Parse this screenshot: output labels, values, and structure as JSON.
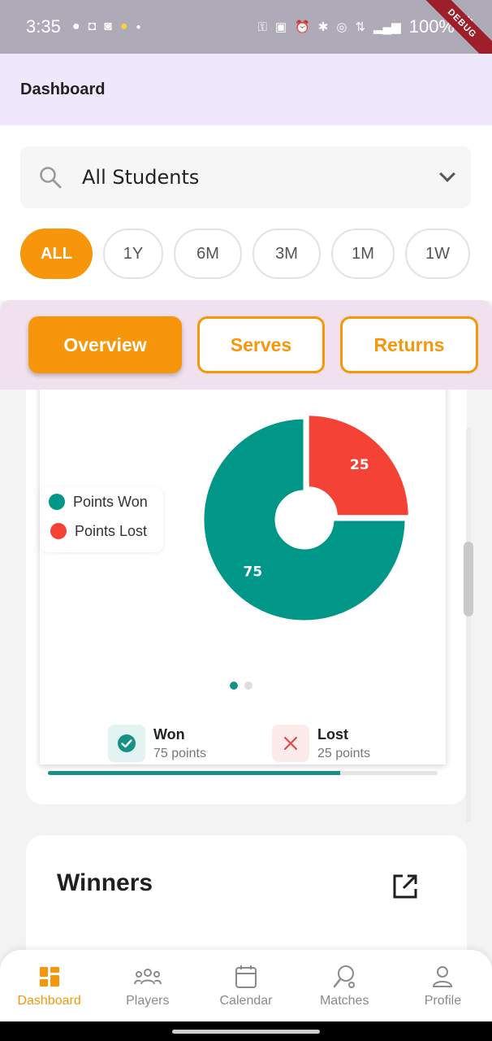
{
  "status_bar": {
    "time": "3:35",
    "battery": "100%",
    "debug_label": "DEBUG"
  },
  "app_bar": {
    "title": "Dashboard"
  },
  "filters": {
    "student_select": "All Students",
    "ranges": [
      "ALL",
      "1Y",
      "6M",
      "3M",
      "1M",
      "1W"
    ],
    "active_range": "ALL"
  },
  "section_tabs": {
    "items": [
      "Overview",
      "Serves",
      "Returns"
    ],
    "active": "Overview"
  },
  "chart_data": {
    "type": "pie",
    "categories": [
      "Points Won",
      "Points Lost"
    ],
    "values": [
      75,
      25
    ],
    "labels": [
      "75",
      "25"
    ],
    "colors": [
      "#009688",
      "#f44336"
    ],
    "legend": "left",
    "donut": true
  },
  "legend": {
    "won_label": "Points Won",
    "lost_label": "Points Lost",
    "won_color": "#009688",
    "lost_color": "#f44336"
  },
  "carousel": {
    "pages": 2,
    "active_page": 1
  },
  "stats": {
    "won_title": "Won",
    "won_sub": "75 points",
    "lost_title": "Lost",
    "lost_sub": "25 points",
    "won_fraction": 0.75
  },
  "winners": {
    "title": "Winners"
  },
  "bottom_nav": {
    "items": [
      {
        "label": "Dashboard",
        "icon": "dashboard-icon"
      },
      {
        "label": "Players",
        "icon": "players-icon"
      },
      {
        "label": "Calendar",
        "icon": "calendar-icon"
      },
      {
        "label": "Matches",
        "icon": "matches-icon"
      },
      {
        "label": "Profile",
        "icon": "profile-icon"
      }
    ],
    "active": "Dashboard"
  },
  "colors": {
    "accent": "#f7960a",
    "teal": "#179185",
    "app_bar_bg": "#efe7fb",
    "tabs_bg": "#f1e1ee"
  }
}
